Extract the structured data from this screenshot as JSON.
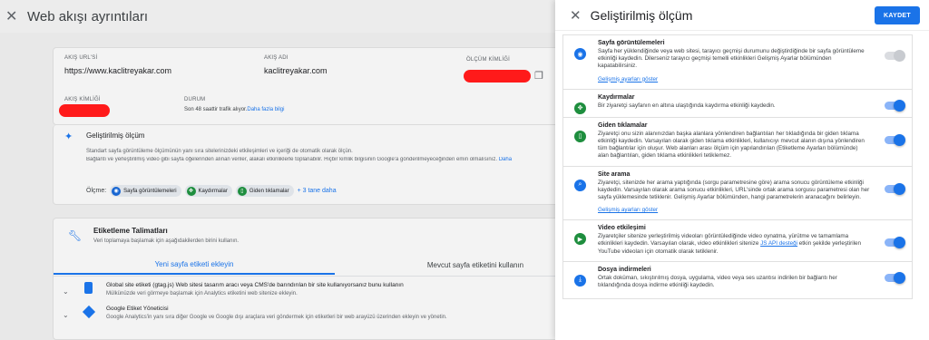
{
  "background": {
    "title": "Web akışı ayrıntıları",
    "stream_url_label": "AKIŞ URL'Sİ",
    "stream_url": "https://www.kaclitreyakar.com",
    "stream_name_label": "AKIŞ ADI",
    "stream_name": "kaclitreyakar.com",
    "measurement_id_label": "ÖLÇÜM KİMLİĞİ",
    "stream_id_label": "AKIŞ KİMLİĞİ",
    "status_label": "DURUM",
    "status_text": "Son 48 saattir trafik alıyor.",
    "status_link": "Daha fazla bilgi",
    "enhanced_title": "Geliştirilmiş ölçüm",
    "enhanced_desc1": "Standart sayfa görüntüleme ölçümünün yanı sıra sitelerinizdeki etkileşimleri ve içeriği de otomatik olarak ölçün.",
    "enhanced_desc2": "Bağlantı ve yerleştirilmiş video gibi sayfa öğelerinden alınan veriler, alakalı etkinliklerle toplanabilir. Hiçbir kimlik bilgisinin Google'a gönderilmeyeceğinden emin olmalısınız.",
    "enhanced_desc_link": "Daha",
    "measuring_label": "Ölçme:",
    "chips": [
      "Sayfa görüntülemeleri",
      "Kaydırmalar",
      "Giden tıklamalar"
    ],
    "more_link": "+ 3 tane daha",
    "tagging_title": "Etiketleme Talimatları",
    "tagging_desc": "Veri toplamaya başlamak için aşağıdakilerden birini kullanın.",
    "tab_new": "Yeni sayfa etiketi ekleyin",
    "tab_existing": "Mevcut sayfa etiketini kullanın",
    "gtag_title": "Global site etiketi (gtag.js) Web sitesi tasarım aracı veya CMS'de barındırılan bir site kullanıyorsanız bunu kullanın",
    "gtag_desc": "Mülkünüzde veri görmeye başlamak için Analytics etiketini web sitenize ekleyin.",
    "gtm_title": "Google Etiket Yöneticisi",
    "gtm_desc": "Google Analytics'in yanı sıra diğer Google ve Google dışı araçlara veri göndermek için etiketleri bir web arayüzü üzerinden ekleyin ve yönetin."
  },
  "panel": {
    "title": "Geliştirilmiş ölçüm",
    "save_label": "KAYDET",
    "sections": [
      {
        "title": "Sayfa görüntülemeleri",
        "desc": "Sayfa her yüklendiğinde veya web sitesi, tarayıcı geçmişi durumunu değiştirdiğinde bir sayfa görüntüleme etkinliği kaydedin. Dilerseniz tarayıcı geçmişi temelli etkinlikleri Gelişmiş Ayarlar bölümünden kapatabilirsiniz.",
        "link": "Gelişmiş ayarları göster",
        "icon": "eye-icon",
        "color": "#1a73e8",
        "enabled": true,
        "locked": true
      },
      {
        "title": "Kaydırmalar",
        "desc": "Bir ziyaretçi sayfanın en altına ulaştığında kaydırma etkinliği kaydedin.",
        "icon": "move-icon",
        "color": "#1e8e3e",
        "enabled": true
      },
      {
        "title": "Giden tıklamalar",
        "desc": "Ziyaretçi onu sizin alanınızdan başka alanlara yönlendiren bağlantıları her tıkladığında bir giden tıklama etkinliği kaydedin. Varsayılan olarak giden tıklama etkinlikleri, kullanıcıyı mevcut alanın dışına yönlendiren tüm bağlantılar için oluşur. Web alanları arası ölçüm için yapılandırılan (Etiketleme Ayarları bölümünde) alan bağlantıları, giden tıklama etkinlikleri tetiklemez.",
        "icon": "mouse-icon",
        "color": "#1e8e3e",
        "enabled": true
      },
      {
        "title": "Site arama",
        "desc": "Ziyaretçi, sitenizde her arama yaptığında (sorgu parametresine göre) arama sonucu görüntüleme etkinliği kaydedin. Varsayılan olarak arama sonucu etkinlikleri, URL'sinde ortak arama sorgusu parametresi olan her sayfa yüklemesinde tetiklenir. Gelişmiş Ayarlar bölümünden, hangi parametrelerin aranacağını belirleyin.",
        "link": "Gelişmiş ayarları göster",
        "icon": "search-icon",
        "color": "#1a73e8",
        "enabled": true
      },
      {
        "title": "Video etkileşimi",
        "desc_parts": [
          "Ziyaretçiler sitenize yerleştirilmiş videoları görüntülediğinde video oynatma, yürütme ve tamamlama etkinlikleri kaydedin. Varsayılan olarak, video etkinlikleri sitenize ",
          "JS API desteği",
          " etkin şekilde yerleştirilen YouTube videoları için otomatik olarak tetiklenir."
        ],
        "icon": "play-icon",
        "color": "#1e8e3e",
        "enabled": true
      },
      {
        "title": "Dosya indirmeleri",
        "desc": "Ortak doküman, sıkıştırılmış dosya, uygulama, video veya ses uzantısı indirilen bir bağlantı her tıklandığında dosya indirme etkinliği kaydedin.",
        "icon": "download-icon",
        "color": "#1a73e8",
        "enabled": true
      }
    ]
  }
}
